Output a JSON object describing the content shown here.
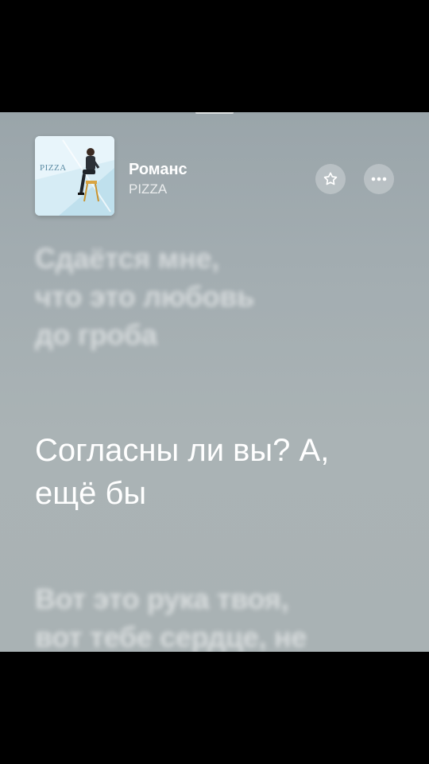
{
  "now_playing": {
    "title": "Романс",
    "artist": "PIZZA",
    "artwork_text": "PIZZA"
  },
  "actions": {
    "favorite_icon": "star-icon",
    "more_icon": "ellipsis-icon"
  },
  "lyrics": {
    "previous": [
      "Сдаётся мне,",
      "что это любовь",
      "до гроба"
    ],
    "current": [
      "Согласны ли вы? А,",
      "ещё бы"
    ],
    "next": [
      "Вот это рука твоя,",
      "вот тебе сердце, не"
    ]
  }
}
